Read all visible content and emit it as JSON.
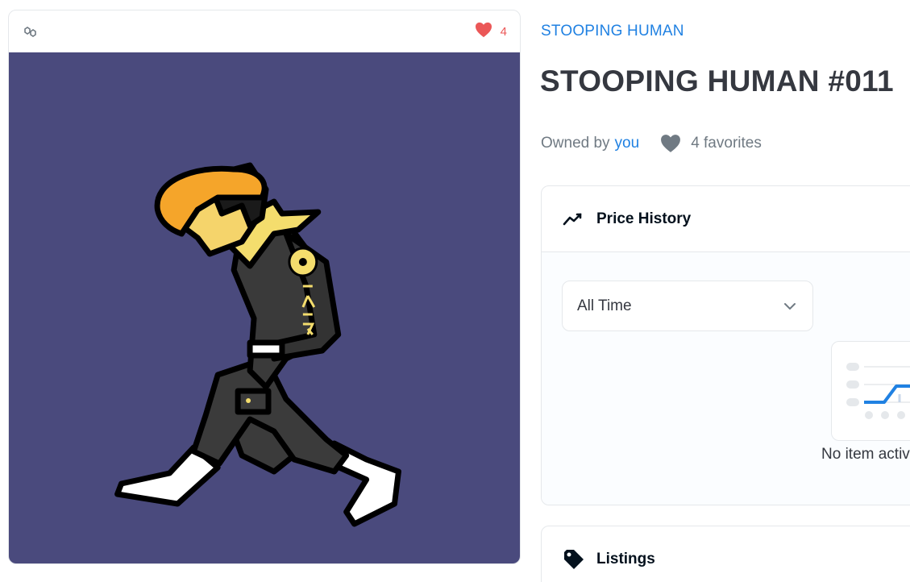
{
  "asset_card": {
    "favorite_count": "4",
    "icons": {
      "chain": "polygon-chain-icon",
      "favorite": "heart-icon"
    },
    "image_background": "#4a4a7d",
    "accent_color": "#eb5757"
  },
  "collection": {
    "name": "STOOPING HUMAN"
  },
  "item": {
    "title": "STOOPING HUMAN #011",
    "owned_by_label": "Owned by",
    "owner": "you",
    "favorites_text": "4 favorites"
  },
  "price_history": {
    "title": "Price History",
    "icon": "trend-line-icon",
    "range_select": {
      "value": "All Time",
      "icon": "chevron-down-icon"
    },
    "empty_state_text": "No item activity yet"
  },
  "listings": {
    "title": "Listings",
    "icon": "tag-icon"
  },
  "colors": {
    "link": "#2081e2",
    "title": "#353840",
    "muted": "#707a83"
  }
}
